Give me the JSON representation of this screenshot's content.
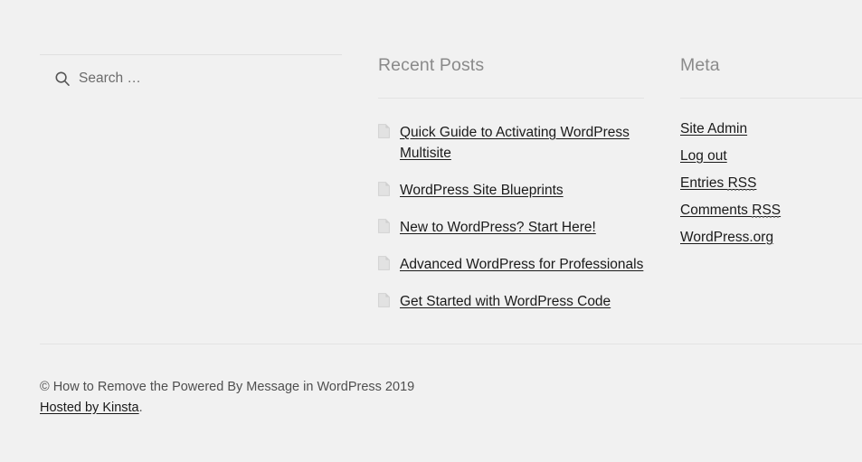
{
  "theme": {
    "background_color": "#f1f1f1",
    "heading_color": "#8a8a8a",
    "link_color": "#1a1a1a",
    "rule_color": "#e3e3e3"
  },
  "search": {
    "icon": "search-icon",
    "placeholder": "Search …",
    "value": ""
  },
  "recent_posts": {
    "title": "Recent Posts",
    "item_icon": "document-icon",
    "items": [
      {
        "label": "Quick Guide to Activating WordPress Multisite"
      },
      {
        "label": "WordPress Site Blueprints"
      },
      {
        "label": "New to WordPress? Start Here!"
      },
      {
        "label": "Advanced WordPress for Professionals"
      },
      {
        "label": "Get Started with WordPress Code"
      }
    ]
  },
  "meta": {
    "title": "Meta",
    "items": [
      {
        "label": "Site Admin",
        "abbr": ""
      },
      {
        "label": "Log out",
        "abbr": ""
      },
      {
        "label": "Entries ",
        "abbr": "RSS"
      },
      {
        "label": "Comments ",
        "abbr": "RSS"
      },
      {
        "label": "WordPress.org",
        "abbr": ""
      }
    ]
  },
  "footer": {
    "copyright": "© How to Remove the Powered By Message in WordPress 2019",
    "host_link": "Hosted by Kinsta",
    "host_period": "."
  }
}
